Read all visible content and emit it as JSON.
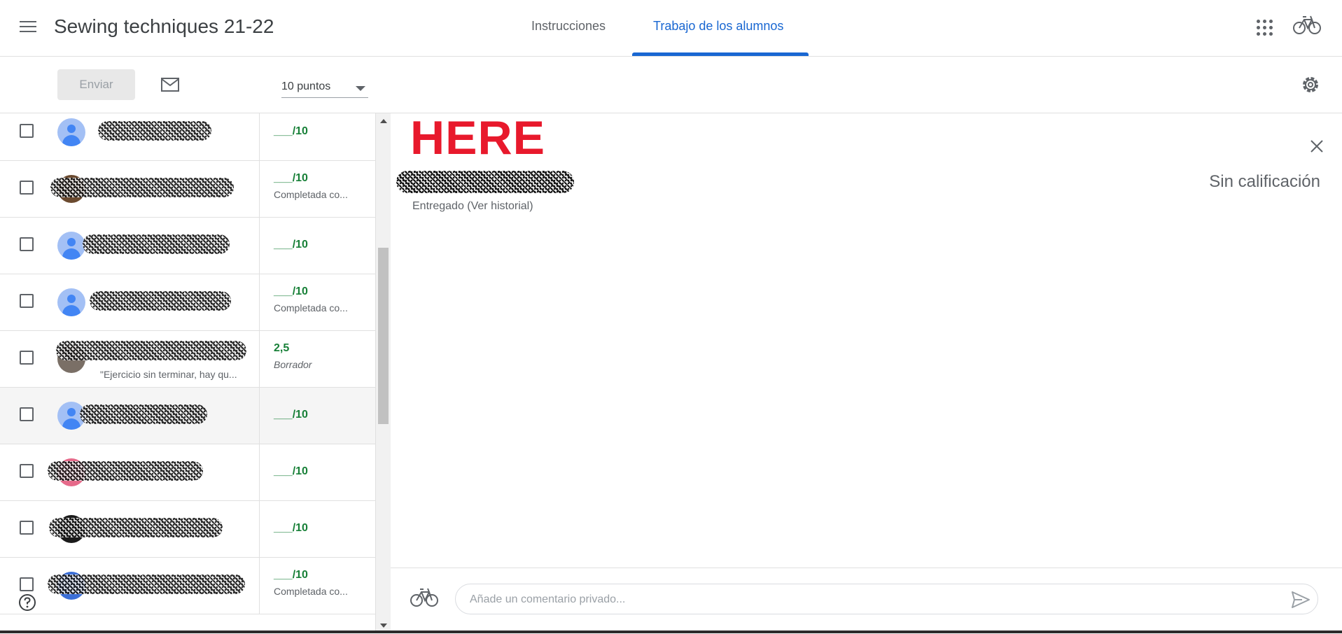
{
  "header": {
    "class_title": "Sewing techniques 21-22",
    "tabs": [
      {
        "label": "Instrucciones",
        "active": false
      },
      {
        "label": "Trabajo de los alumnos",
        "active": true
      }
    ],
    "accent_color": "#1967d2"
  },
  "toolbar": {
    "send_label": "Enviar",
    "points_value": "10 puntos"
  },
  "students": [
    {
      "grade": "___/10",
      "status": "",
      "comment": ""
    },
    {
      "grade": "___/10",
      "status": "Completada co...",
      "comment": ""
    },
    {
      "grade": "___/10",
      "status": "",
      "comment": ""
    },
    {
      "grade": "___/10",
      "status": "Completada co...",
      "comment": ""
    },
    {
      "grade": "2,5",
      "status": "Borrador",
      "comment": "\"Ejercicio sin terminar, hay qu..."
    },
    {
      "grade": "___/10",
      "status": "",
      "comment": ""
    },
    {
      "grade": "___/10",
      "status": "",
      "comment": ""
    },
    {
      "grade": "___/10",
      "status": "",
      "comment": ""
    },
    {
      "grade": "___/10",
      "status": "Completada co...",
      "comment": ""
    }
  ],
  "detail": {
    "annotation": "HERE",
    "grade_status": "Sin calificación",
    "submission_status": "Entregado (Ver historial)",
    "comment_placeholder": "Añade un comentario privado..."
  },
  "icons": [
    "hamburger-menu-icon",
    "apps-grid-icon",
    "bicycle-icon",
    "mail-icon",
    "settings-gear-icon",
    "close-icon",
    "help-icon",
    "send-icon"
  ],
  "colors": {
    "grade_green": "#188038",
    "annotation_red": "#e8192c"
  }
}
